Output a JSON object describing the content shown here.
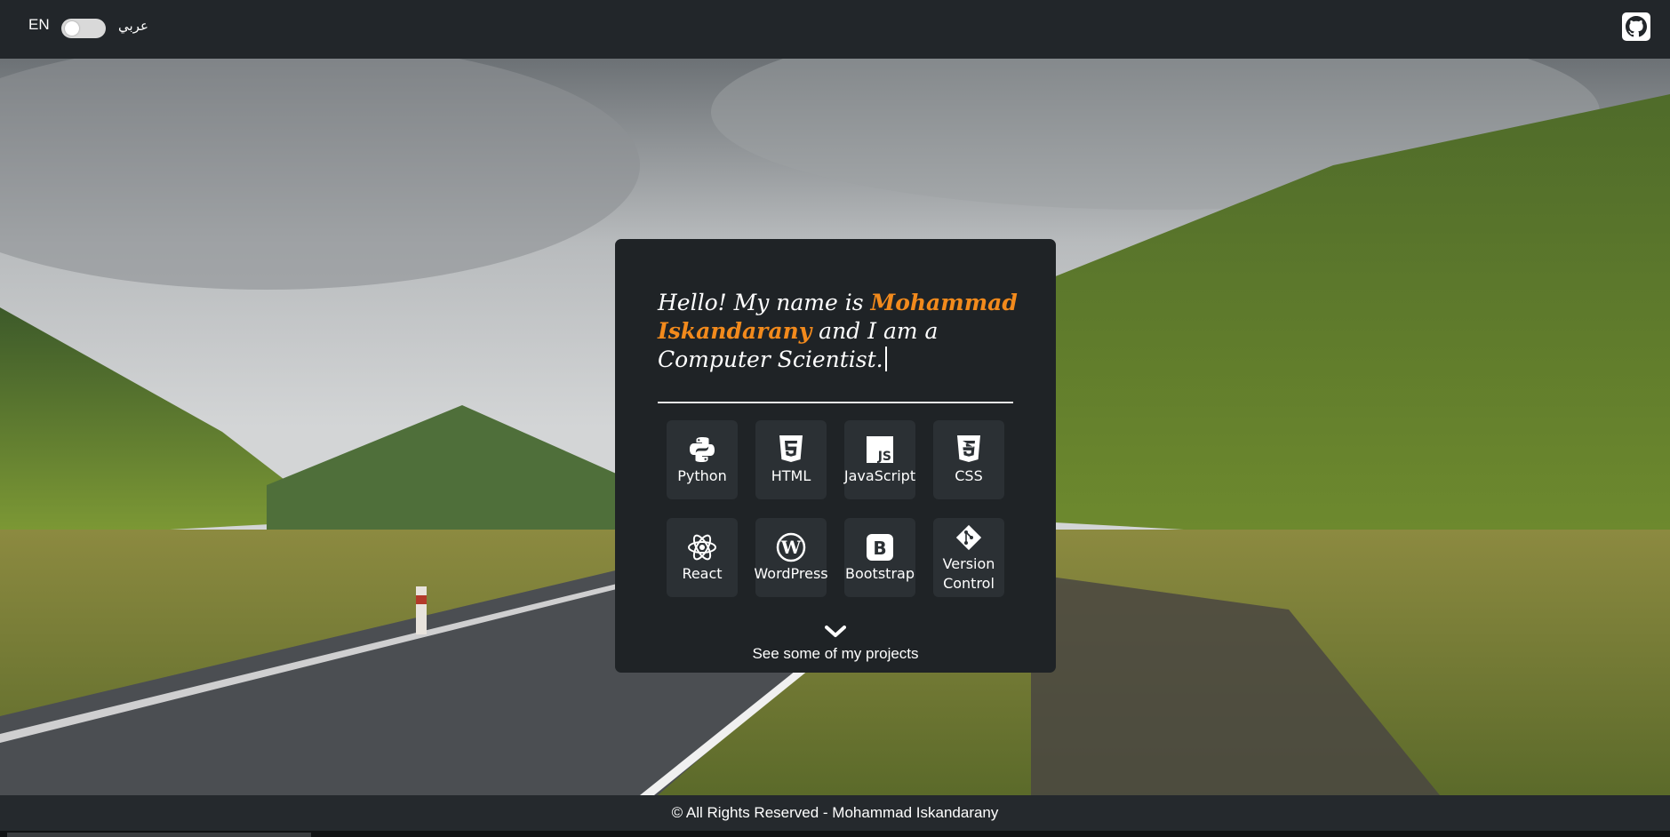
{
  "header": {
    "lang_en": "EN",
    "lang_ar": "عربي",
    "github_icon": "github-icon"
  },
  "intro": {
    "prefix": "Hello! My name is ",
    "name": "Mohammad Iskandarany",
    "suffix": " and I am a Computer Scientist."
  },
  "skills": [
    {
      "label": "Python",
      "icon": "python-icon"
    },
    {
      "label": "HTML",
      "icon": "html5-icon"
    },
    {
      "label": "JavaScript",
      "icon": "js-icon"
    },
    {
      "label": "CSS",
      "icon": "css3-icon"
    },
    {
      "label": "React",
      "icon": "react-icon"
    },
    {
      "label": "WordPress",
      "icon": "wordpress-icon"
    },
    {
      "label": "Bootstrap",
      "icon": "bootstrap-icon"
    },
    {
      "label": "Version Control",
      "icon": "git-icon"
    }
  ],
  "projects_link": "See some of my projects",
  "footer": "© All Rights Reserved - Mohammad Iskandarany",
  "colors": {
    "accent": "#f28a1c",
    "card": "#1f2326",
    "tile": "#2b3034",
    "bar": "#22262a"
  }
}
